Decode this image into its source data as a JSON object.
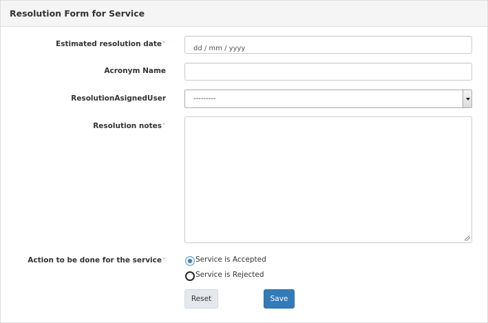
{
  "form": {
    "title": "Resolution Form for Service",
    "required_marker": "*",
    "fields": {
      "estimated_date": {
        "label": "Estimated resolution date",
        "placeholder": "dd / mm / yyyy"
      },
      "acronym_name": {
        "label": "Acronym Name",
        "value": ""
      },
      "assigned_user": {
        "label": "ResolutionAsignedUser",
        "selected": "---------"
      },
      "notes": {
        "label": "Resolution notes",
        "value": ""
      },
      "action": {
        "label": "Action to be done for the service",
        "options": [
          {
            "label": "Service is Accepted",
            "checked": true
          },
          {
            "label": "Service is Rejected",
            "checked": false
          }
        ]
      }
    },
    "buttons": {
      "reset": "Reset",
      "save": "Save"
    }
  },
  "colors": {
    "primary_button": "#337ab7",
    "secondary_button": "#e4e8ec",
    "required_marker": "#d9a3a3",
    "heading_background": "#f5f5f5"
  }
}
